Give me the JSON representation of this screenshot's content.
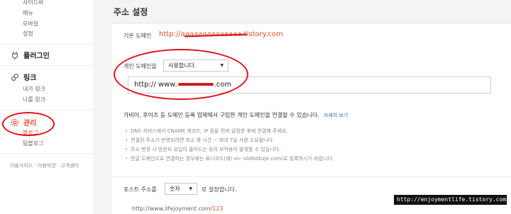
{
  "sidebar": {
    "design_subitems": [
      "사이드바",
      "메뉴",
      "모바일",
      "설정"
    ],
    "plugin": {
      "label": "플러그인",
      "icon": "plug-icon"
    },
    "link": {
      "label": "링크",
      "icon": "link-icon",
      "items": [
        "내가 링크",
        "나를 링크"
      ]
    },
    "manage": {
      "label": "관리",
      "icon": "gear-icon",
      "items": [
        "블로그",
        "팀블로그"
      ]
    },
    "footer": "이용가이드 · 이용약관 · 고객센터"
  },
  "page_title": "주소 설정",
  "basic_domain": {
    "label": "기본 도메인",
    "url": "http://aaaaaaaaaaaaaa.tistory.com"
  },
  "personal_domain": {
    "label": "개인 도메인을",
    "select_value": "사용합니다.",
    "input_prefix": "http://",
    "input_start": "www.",
    "input_end": ".com"
  },
  "description": {
    "text": "가비아, 후이즈 등 도메인 등록 업체에서 구입한 개인 도메인을 연결할 수 있습니다.",
    "link": "자세히 보기",
    "bullets": [
      "DNS 서비스에서 CNAME 레코드, IP 등을 먼저 설정한 후에 연결해 주세요.",
      "연결된 주소가 반영되려면 최소 몇 시간 ~ 최대 7일 가량 소요됩니다.",
      "주소 변경 시 방문자 유입이 줄어드는 등의 부작용이 발생할 수 있습니다.",
      "한글 도메인으로 연결하는 경우에는 퓨니코드(예) xn--vb0b0bzje.com)로 등록하시기 바랍니다."
    ]
  },
  "post_address": {
    "label": "포스트 주소를",
    "select_value": "숫자",
    "suffix": "로 설정합니다.",
    "example_prefix": "http://www.lifejoyment.com/",
    "example_num": "123"
  },
  "watermark": "http://enjoymentlife.tistory.com",
  "colors": {
    "accent": "#e34c2c",
    "annotation": "#e01018"
  }
}
